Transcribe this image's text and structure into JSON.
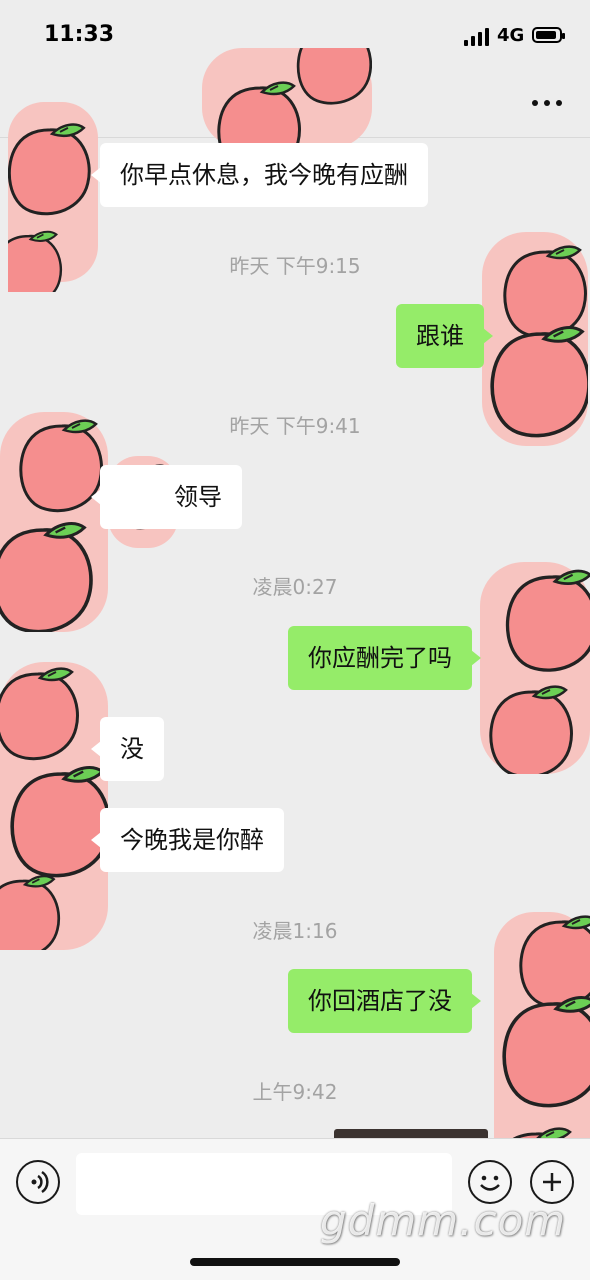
{
  "status_bar": {
    "time": "11:33",
    "network": "4G"
  },
  "nav": {
    "more_icon": "more-dots-icon"
  },
  "messages": [
    {
      "side": "left",
      "text": "你早点休息，我今晚有应酬"
    },
    {
      "type": "time",
      "text": "昨天 下午9:15"
    },
    {
      "side": "right",
      "text": "跟谁"
    },
    {
      "type": "time",
      "text": "昨天 下午9:41"
    },
    {
      "side": "left",
      "text": "领导"
    },
    {
      "type": "time",
      "text": "凌晨0:27"
    },
    {
      "side": "right",
      "text": "你应酬完了吗"
    },
    {
      "side": "left",
      "text": "没"
    },
    {
      "side": "left",
      "text": "今晚我是你醉"
    },
    {
      "type": "time",
      "text": "凌晨1:16"
    },
    {
      "side": "right",
      "text": "你回酒店了没"
    },
    {
      "type": "time",
      "text": "上午9:42"
    }
  ],
  "input_bar": {
    "voice_icon": "voice-icon",
    "emoji_icon": "emoji-icon",
    "plus_icon": "plus-icon",
    "input_value": ""
  },
  "watermark": "gdmm.com",
  "colors": {
    "background": "#ededed",
    "sent_bubble": "#95ec69",
    "received_bubble": "#ffffff",
    "peach": "#f7a3a3",
    "leaf": "#5cc84a"
  }
}
